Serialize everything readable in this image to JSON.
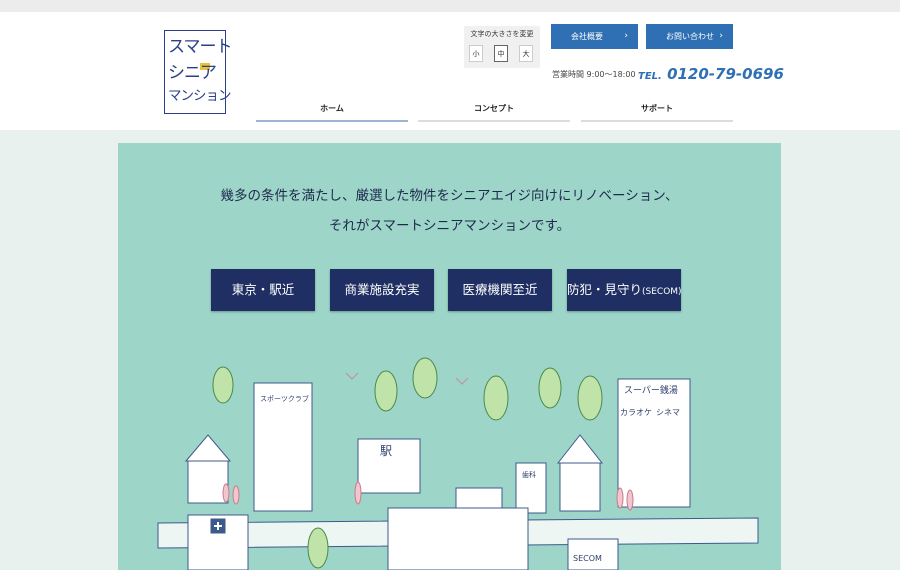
{
  "logo": {
    "lines": [
      "スマート",
      "シニア",
      "マンション"
    ]
  },
  "font_size": {
    "label": "文字の大きさを変更",
    "small": "小",
    "medium": "中",
    "large": "大"
  },
  "top_buttons": {
    "company": "会社概要",
    "contact": "お問い合わせ"
  },
  "contact": {
    "hours": "営業時間 9:00〜18:00",
    "tel_prefix": "TEL.",
    "tel_number": "0120-79-0696"
  },
  "nav": {
    "home": "ホーム",
    "concept": "コンセプト",
    "support": "サポート"
  },
  "hero": {
    "tagline1": "幾多の条件を満たし、厳選した物件をシニアエイジ向けにリノベーション、",
    "tagline2": "それがスマートシニアマンションです。",
    "features": {
      "station": "東京・駅近",
      "commerce": "商業施設充実",
      "medical": "医療機関至近",
      "security_main": "防犯・見守り",
      "security_sub": "(SECOM)"
    },
    "illustration_labels": {
      "sports": "スポーツクラブ",
      "station": "駅",
      "supermarket": "スーパー銭湯",
      "karaoke": "カラオケ",
      "cinema": "シネマ",
      "dental": "歯科",
      "secom": "SECOM"
    }
  },
  "colors": {
    "accent": "#2f6fb3",
    "navy": "#1f2f63",
    "hero_bg": "#9dd5c9"
  }
}
